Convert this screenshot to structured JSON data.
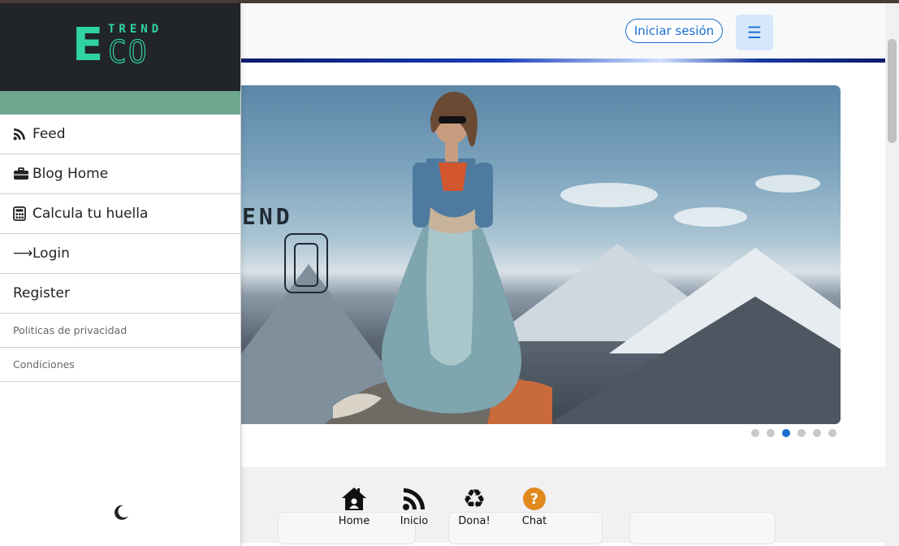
{
  "navbar": {
    "login_label": "Iniciar sesión",
    "menu_icon": "hamburger-icon"
  },
  "brand": {
    "big_letter": "E",
    "top_text": "TREND",
    "bottom_text": "CO",
    "color": "#2fd4a0"
  },
  "sidebar": {
    "items": [
      {
        "label": "Feed",
        "icon": "rss-icon"
      },
      {
        "label": "Blog Home",
        "icon": "briefcase-icon"
      },
      {
        "label": "Calcula tu huella",
        "icon": "calculator-icon"
      },
      {
        "label": "Login",
        "icon": "arrow-right-icon"
      },
      {
        "label": "Register",
        "icon": ""
      }
    ],
    "small_links": [
      {
        "label": "Politicas de privacidad"
      },
      {
        "label": "Condiciones"
      }
    ],
    "theme_toggle_icon": "moon-icon"
  },
  "carousel": {
    "slide_logo_text": "END",
    "slide_count": 6,
    "active_index": 2
  },
  "bottom_nav": [
    {
      "label": "Home",
      "icon": "home-icon"
    },
    {
      "label": "Inicio",
      "icon": "rss-icon"
    },
    {
      "label": "Dona!",
      "icon": "recycle-icon"
    },
    {
      "label": "Chat",
      "icon": "question-circle-icon"
    }
  ],
  "colors": {
    "accent": "#1b6fd1",
    "sidebar_header": "#212529",
    "sidebar_strip": "#6ea68f",
    "chat_icon": "#e08a1e"
  }
}
